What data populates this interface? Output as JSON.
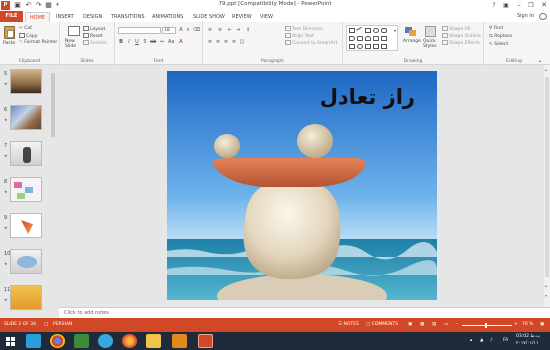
{
  "window": {
    "title": "79.ppt [Compatibility Mode] - PowerPoint",
    "help": "?",
    "sign_in": "Sign in"
  },
  "tabs": [
    "FILE",
    "HOME",
    "INSERT",
    "DESIGN",
    "TRANSITIONS",
    "ANIMATIONS",
    "SLIDE SHOW",
    "REVIEW",
    "VIEW"
  ],
  "ribbon": {
    "clipboard": {
      "label": "Clipboard",
      "paste": "Paste",
      "cut": "Cut",
      "copy": "Copy",
      "format_painter": "Format Painter"
    },
    "slides": {
      "label": "Slides",
      "new_slide": "New Slide",
      "layout": "Layout",
      "reset": "Reset",
      "section": "Section"
    },
    "font": {
      "label": "Font",
      "size": "18"
    },
    "paragraph": {
      "label": "Paragraph",
      "text_direction": "Text Direction",
      "align_text": "Align Text",
      "convert_smartart": "Convert to SmartArt"
    },
    "drawing": {
      "label": "Drawing",
      "arrange": "Arrange",
      "quick_styles": "Quick Styles",
      "shape_fill": "Shape Fill",
      "shape_outline": "Shape Outline",
      "shape_effects": "Shape Effects"
    },
    "editing": {
      "label": "Editing",
      "find": "Find",
      "replace": "Replace",
      "select": "Select"
    }
  },
  "thumbnails": [
    {
      "num": "5"
    },
    {
      "num": "6"
    },
    {
      "num": "7"
    },
    {
      "num": "8"
    },
    {
      "num": "9"
    },
    {
      "num": "10"
    },
    {
      "num": "11"
    }
  ],
  "slide": {
    "title": "راز تعادل"
  },
  "notes": {
    "placeholder": "Click to add notes"
  },
  "status": {
    "slide_info": "SLIDE 2 OF 34",
    "language": "PERSIAN",
    "notes": "NOTES",
    "comments": "COMMENTS",
    "zoom": "70 %"
  },
  "taskbar": {
    "lang": "FA",
    "time": "03:02 ب.ظ",
    "date": "۲۰۱۷/۰۱/۱۱"
  },
  "colors": {
    "accent": "#d24726",
    "taskbar": "#1f2a3a"
  }
}
